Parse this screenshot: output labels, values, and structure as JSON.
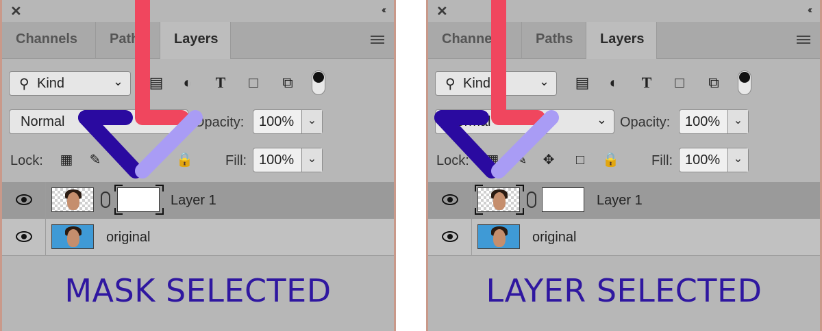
{
  "panels": [
    {
      "tabs": [
        "Channels",
        "Paths",
        "Layers"
      ],
      "filter": {
        "kind_label": "Kind"
      },
      "blend": {
        "mode": "Normal"
      },
      "opacity": {
        "label": "Opacity:",
        "value": "100%"
      },
      "lock": {
        "label": "Lock:"
      },
      "fill": {
        "label": "Fill:",
        "value": "100%"
      },
      "layers": [
        {
          "name": "Layer 1",
          "selected": true,
          "selection_target": "mask"
        },
        {
          "name": "original",
          "selected": false
        }
      ],
      "caption": "MASK SELECTED"
    },
    {
      "tabs": [
        "Channels",
        "Paths",
        "Layers"
      ],
      "filter": {
        "kind_label": "Kind"
      },
      "blend": {
        "mode": "Normal"
      },
      "opacity": {
        "label": "Opacity:",
        "value": "100%"
      },
      "lock": {
        "label": "Lock:"
      },
      "fill": {
        "label": "Fill:",
        "value": "100%"
      },
      "layers": [
        {
          "name": "Layer 1",
          "selected": true,
          "selection_target": "layer"
        },
        {
          "name": "original",
          "selected": false
        }
      ],
      "caption": "LAYER SELECTED"
    }
  ],
  "icons": {
    "close": "✕",
    "collapse": "‹‹",
    "search": "⌕",
    "chevron": "⌄"
  },
  "colors": {
    "arrow_red": "#f0465e",
    "arrow_dark_purple": "#2a0aa0",
    "arrow_light_purple": "#a99cf5",
    "caption": "#2f17a0"
  }
}
